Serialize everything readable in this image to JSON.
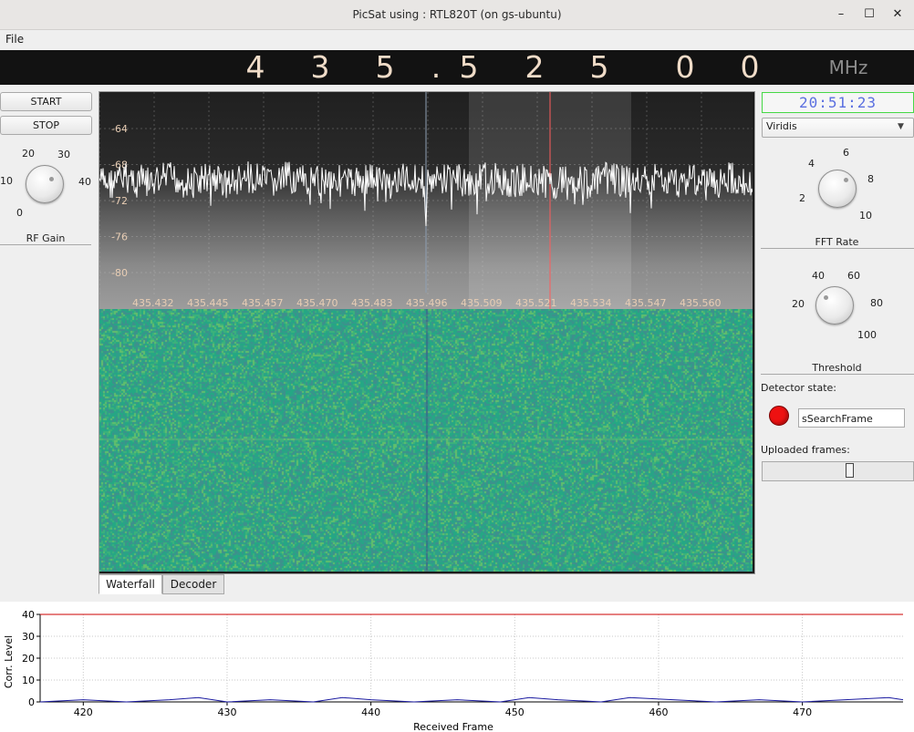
{
  "window": {
    "title": "PicSat using : RTL820T (on gs-ubuntu)",
    "minimize": "–",
    "maximize": "☐",
    "close": "✕"
  },
  "menu": {
    "file": "File"
  },
  "frequency": {
    "digits": [
      "4",
      "3",
      "5",
      ".",
      "5",
      "2",
      "5",
      "0",
      "0"
    ],
    "unit": "MHz"
  },
  "controls": {
    "start": "START",
    "stop": "STOP",
    "rf_gain": {
      "label": "RF Gain",
      "ticks": [
        "0",
        "10",
        "20",
        "30",
        "40"
      ]
    }
  },
  "spectrum": {
    "y_ticks": [
      "-64",
      "-68",
      "-72",
      "-76",
      "-80"
    ],
    "x_ticks": [
      "435.432",
      "435.445",
      "435.457",
      "435.470",
      "435.483",
      "435.496",
      "435.509",
      "435.521",
      "435.534",
      "435.547",
      "435.560"
    ]
  },
  "tabs": [
    "Waterfall",
    "Decoder"
  ],
  "right_panel": {
    "clock": "20:51:23",
    "colormap": "Viridis",
    "fft_rate": {
      "label": "FFT Rate",
      "ticks": [
        "2",
        "4",
        "6",
        "8",
        "10"
      ]
    },
    "threshold": {
      "label": "Threshold",
      "ticks": [
        "20",
        "40",
        "60",
        "80",
        "100"
      ]
    },
    "detector_label": "Detector state:",
    "detector_state": "sSearchFrame",
    "uploaded_label": "Uploaded frames:"
  },
  "colors": {
    "threshold_line": "#cc0000",
    "corr_line": "#1a1aa0",
    "detector_led": "#ee1111"
  },
  "chart_data": {
    "type": "line",
    "title": "",
    "xlabel": "Received Frame",
    "ylabel": "Corr. Level",
    "xlim": [
      417,
      477
    ],
    "ylim": [
      0,
      40
    ],
    "x_ticks": [
      420,
      430,
      440,
      450,
      460,
      470
    ],
    "y_ticks": [
      0,
      10,
      20,
      30,
      40
    ],
    "grid": true,
    "series": [
      {
        "x": [
          417,
          477
        ],
        "values": [
          40,
          40
        ]
      },
      {
        "x": [
          417,
          420,
          423,
          426,
          428,
          430,
          433,
          436,
          438,
          440,
          443,
          446,
          449,
          451,
          453,
          456,
          458,
          461,
          464,
          467,
          470,
          473,
          476,
          477
        ],
        "values": [
          0,
          1,
          0,
          1,
          2,
          0,
          1,
          0,
          2,
          1,
          0,
          1,
          0,
          2,
          1,
          0,
          2,
          1,
          0,
          1,
          0,
          1,
          2,
          1
        ]
      }
    ]
  }
}
